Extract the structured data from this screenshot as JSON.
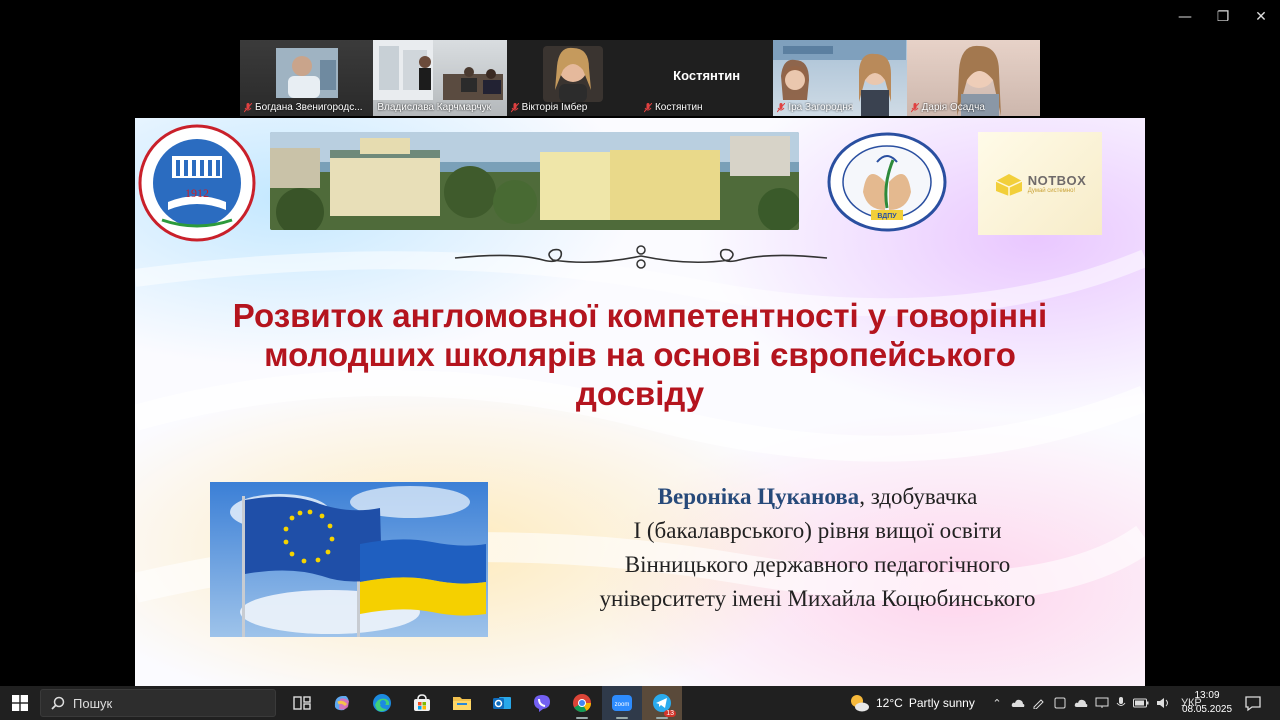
{
  "window": {
    "minimize": "—",
    "maximize": "❐",
    "close": "✕"
  },
  "participants": [
    {
      "name": "Богдана Звенигородс...",
      "muted": true,
      "active": false,
      "type": "video"
    },
    {
      "name": "Владислава Карчмарчук",
      "muted": false,
      "active": true,
      "type": "video"
    },
    {
      "name": "Вікторія Імбер",
      "muted": true,
      "active": false,
      "type": "video"
    },
    {
      "name": "Костянтин",
      "muted": true,
      "active": false,
      "type": "name-only",
      "display": "Костянтин"
    },
    {
      "name": "Іра  Загородня",
      "muted": true,
      "active": false,
      "type": "video"
    },
    {
      "name": "Дарія Осадча",
      "muted": true,
      "active": false,
      "type": "video"
    }
  ],
  "slide": {
    "univ_logo_year": "1912",
    "notbox_title": "NOTBOX",
    "notbox_sub": "Думай системно!",
    "dept_logo_text": "ВДПУ",
    "title_lines": [
      "Розвиток англомовної компетентності у говорінні",
      "молодших школярів на основі європейського",
      "досвіду"
    ],
    "author_name": "Вероніка Цуканова",
    "author_line1_rest": ", здобувачка",
    "author_lines": [
      "І (бакалаврського) рівня вищої освіти",
      "Вінницького державного педагогічного",
      "університету імені Михайла Коцюбинського"
    ]
  },
  "taskbar": {
    "search_placeholder": "Пошук",
    "pinned": [
      "task-view-icon",
      "copilot-icon",
      "edge-icon",
      "store-icon",
      "file-explorer-icon",
      "outlook-icon",
      "viber-icon",
      "chrome-icon",
      "zoom-icon",
      "telegram-icon"
    ],
    "zoom_label": "zoom",
    "telegram_badge": "13",
    "weather_temp": "12°C",
    "weather_desc": "Partly sunny",
    "language": "УКР",
    "time": "13:09",
    "date": "08.05.2025"
  },
  "colors": {
    "title": "#b4141e",
    "author_name": "#274a7a",
    "active_outline": "#3ad36a",
    "taskbar": "#202020"
  }
}
